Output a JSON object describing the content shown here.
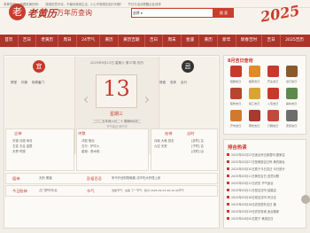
{
  "topbar": {
    "items": [
      "老黄历网",
      "收藏老黄历网：",
      "按维权意识化，不偏问使用生活，小心不断规划自行判断！",
      "节日与活动提醒点此请求"
    ]
  },
  "header": {
    "logo_char": "老",
    "logo_text": "老黄历",
    "subtitle": "万年历查询",
    "search_select": "选择",
    "search_button": "搜 索",
    "deco_year": "2025"
  },
  "nav": {
    "items": [
      "首页",
      "吉日",
      "老黄历",
      "周日",
      "24节气",
      "黄历",
      "黄历吉期",
      "吉日",
      "周末",
      "星座",
      "黄历",
      "新年",
      "新春吉时",
      "吉日",
      "2025吉历"
    ]
  },
  "date_panel": {
    "yi_char": "宜",
    "ji_char": "忌",
    "yi_items": [
      "修堂",
      "印造",
      "除修畜门"
    ],
    "ji_items": [
      "修造",
      "安床",
      "出行"
    ],
    "gregorian": "2025年9月13日 星期六 第37周 农历",
    "day_number": "13",
    "weekday": "星期三",
    "lunar_text": "二〇二五年闰六月二十 周期6月初二",
    "footnote": "节气临近 丙午时"
  },
  "grid": {
    "jishen_title": "吉神",
    "jishen_text": [
      "天德 月德 母仓",
      "五富 五合 金匮",
      "天恩 时德"
    ],
    "chongsha_title": "冲煞",
    "chongsha_text": [
      "冲鼠 煞北",
      "五行：炉中火",
      "星宿：角木蛟"
    ],
    "xiongshen_title": "凶神",
    "xiongshen_text": [
      "月破 大耗 四击",
      "九空 天吏"
    ],
    "jishi_title": "吉时",
    "jishi_text": [
      "[亥时] 吉",
      "[子时] 吉",
      "[戌时] 凶"
    ],
    "zhishen_title": "值神",
    "zhishen_text": "天刑 黑道",
    "pengzu_title": "彭祖百忌",
    "pengzu_text": "甲不开仓财物耗散 戌不吃犬作怪上床",
    "taishen_title": "今日胎神",
    "taishen_text": "占门炉外东北",
    "jieqi_title": "节气",
    "jieqi_text": "当前节气：白露 下一节气：秋分 2025-09-23 06:19:40节气"
  },
  "right": {
    "ji_title": "8月吉日查询",
    "ji_icons": [
      {
        "label": "结婚吉日",
        "color": "#c8392b"
      },
      {
        "label": "搬家吉日",
        "color": "#e08a2c"
      },
      {
        "label": "开业吉日",
        "color": "#c8392b"
      },
      {
        "label": "出行吉日",
        "color": "#8a5a2c"
      },
      {
        "label": "装修吉日",
        "color": "#b5462f"
      },
      {
        "label": "动工吉日",
        "color": "#d9a33a"
      },
      {
        "label": "入宅吉日",
        "color": "#c8392b"
      },
      {
        "label": "提车吉日",
        "color": "#5d8a4a"
      },
      {
        "label": "开市吉日",
        "color": "#d17a2f"
      },
      {
        "label": "祭祀吉日",
        "color": "#a33b2e"
      },
      {
        "label": "订婚吉日",
        "color": "#c24a3c"
      },
      {
        "label": "安床吉日",
        "color": "#6d6d6d"
      }
    ],
    "hot_title": "排吉热读",
    "hot_items": [
      "2025年02月22日适合乔迁新居吗 搬家吉",
      "2025年02月27日是黄道吉日吗 黄历新址",
      "2025年03月10日属于今日吉日 今日是什",
      "2025年03月11日黄历吉日 宜忌对照",
      "2025年03月11日农历 节气适合",
      "2025年03月11日是吉日吗 结婚吉",
      "2025年03月16日是吉日吗 乔迁吉",
      "2025年03月18日农历提车吉日 搬",
      "2025年03月19日农历查询 适合搬家",
      "2025年04月20日属于 黄道吉日"
    ]
  }
}
